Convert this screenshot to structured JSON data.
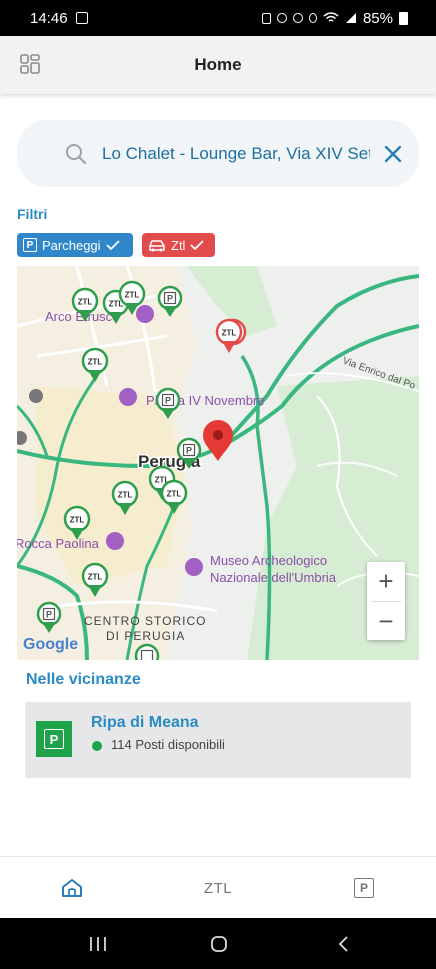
{
  "status_bar": {
    "time": "14:46",
    "battery": "85%"
  },
  "appbar": {
    "title": "Home"
  },
  "search": {
    "value": "Lo Chalet - Lounge Bar, Via XIV Settembre"
  },
  "filters": {
    "label": "Filtri",
    "chips": [
      {
        "label": "Parcheggi",
        "color": "#2f86c9"
      },
      {
        "label": "Ztl",
        "color": "#e14b4b"
      }
    ]
  },
  "map": {
    "labels": {
      "arco": "Arco Etrusco",
      "piazza": "Piazza IV Novembre",
      "perugia": "Perugia",
      "rocca": "Rocca Paolina",
      "museo1": "Museo Archeologico",
      "museo2": "Nazionale dell'Umbria",
      "centro1": "CENTRO STORICO",
      "centro2": "DI PERUGIA",
      "via_enrico": "Via Enrico dal Po",
      "google": "Google"
    },
    "ztl_marker_text": "ZTL",
    "zoom_in": "+",
    "zoom_out": "−",
    "colors": {
      "ztl_marker": "#e14b4b",
      "green_marker": "#2e9e4c",
      "road": "#39b77f",
      "selected_pin": "#e53935"
    }
  },
  "nearby": {
    "label": "Nelle vicinanze",
    "items": [
      {
        "name": "Ripa di Meana",
        "availability": "114 Posti disponibili",
        "status_color": "#1fa34a"
      }
    ]
  },
  "bottom_nav": {
    "items": [
      {
        "id": "home",
        "icon": "home-icon"
      },
      {
        "id": "ztl",
        "label": "ZTL"
      },
      {
        "id": "parking",
        "icon": "parking-icon",
        "glyph": "P"
      }
    ]
  },
  "parking_glyph": "P"
}
